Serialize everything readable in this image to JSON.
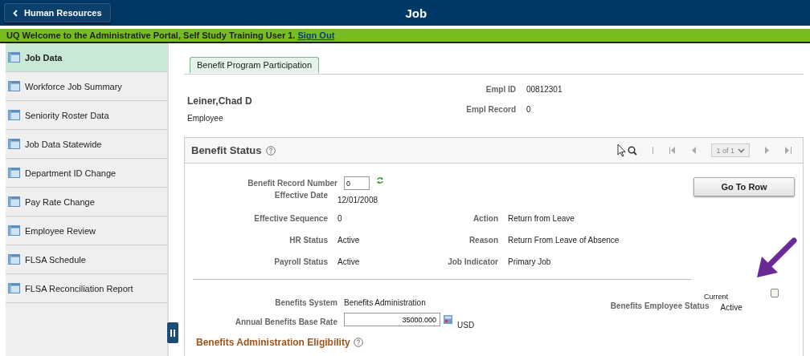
{
  "header": {
    "back_button": "Human Resources",
    "title": "Job"
  },
  "banner": {
    "text": "UQ Welcome to the Administrative Portal, Self Study Training User 1.",
    "link": "Sign Out"
  },
  "sidebar": {
    "items": [
      {
        "label": "Job Data",
        "selected": true
      },
      {
        "label": "Workforce Job Summary",
        "selected": false
      },
      {
        "label": "Seniority Roster Data",
        "selected": false
      },
      {
        "label": "Job Data Statewide",
        "selected": false
      },
      {
        "label": "Department ID Change",
        "selected": false
      },
      {
        "label": "Pay Rate Change",
        "selected": false
      },
      {
        "label": "Employee Review",
        "selected": false
      },
      {
        "label": "FLSA Schedule",
        "selected": false
      },
      {
        "label": "FLSA Reconciliation Report",
        "selected": false
      }
    ]
  },
  "tab": {
    "label": "Benefit Program Participation",
    "selected": true
  },
  "employee": {
    "name": "Leiner,Chad D",
    "type": "Employee",
    "fields": [
      {
        "label": "Empl ID",
        "value": "00812301"
      },
      {
        "label": "Empl Record",
        "value": "0"
      }
    ]
  },
  "benefit_status": {
    "title": "Benefit Status",
    "pager": "1 of 1",
    "go_to_row": "Go To Row",
    "record_number": {
      "label": "Benefit Record Number",
      "value": "0"
    },
    "rows": [
      {
        "left_label": "Effective Date",
        "left_value": "12/01/2008"
      },
      {
        "left_label": "Effective Sequence",
        "left_value": "0",
        "right_label": "Action",
        "right_value": "Return from Leave"
      },
      {
        "left_label": "HR Status",
        "left_value": "Active",
        "right_label": "Reason",
        "right_value": "Return From Leave of Absence"
      },
      {
        "left_label": "Payroll Status",
        "left_value": "Active",
        "right_label": "Job Indicator",
        "right_value": "Primary Job"
      }
    ],
    "current": {
      "label": "Current",
      "checked": false
    },
    "benefits_system": {
      "label": "Benefits System",
      "value": "Benefits Administration"
    },
    "employee_status": {
      "label": "Benefits Employee Status",
      "value": "Active"
    },
    "base_rate": {
      "label": "Annual Benefits Base Rate",
      "value": "35000.000",
      "currency": "USD"
    }
  },
  "eligibility": {
    "title": "Benefits Administration Eligibility"
  }
}
